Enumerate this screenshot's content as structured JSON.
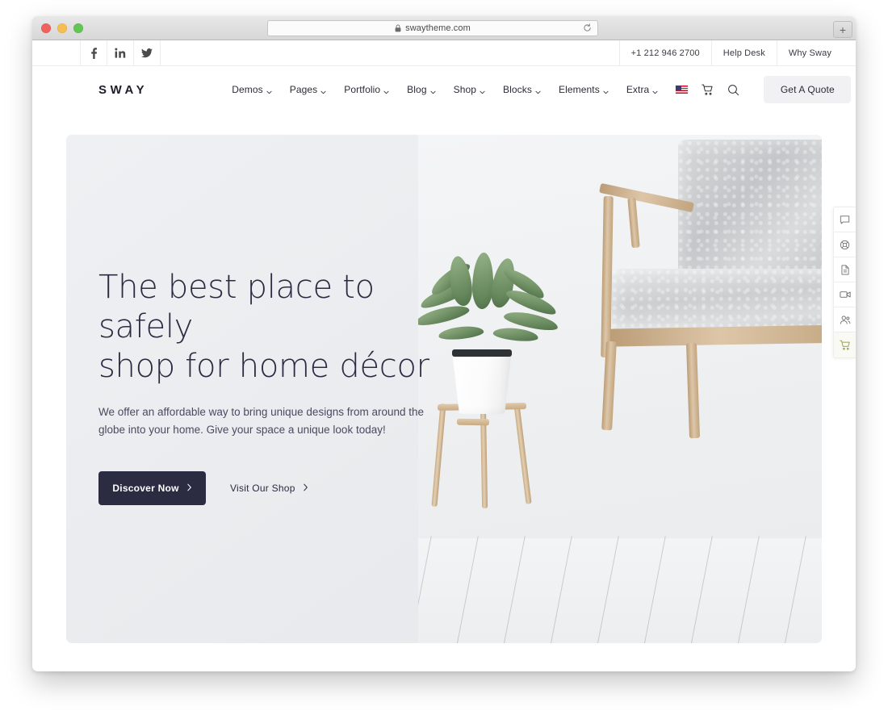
{
  "browser": {
    "url": "swaytheme.com",
    "lock_icon": "lock-icon",
    "reload_icon": "reload-icon",
    "new_tab_label": "+",
    "traffic_lights": [
      "close-button",
      "minimize-button",
      "maximize-button"
    ]
  },
  "topbar": {
    "social": [
      {
        "name": "facebook-icon",
        "label": "f"
      },
      {
        "name": "linkedin-icon",
        "label": "in"
      },
      {
        "name": "twitter-icon",
        "label": "twitter"
      }
    ],
    "links": [
      {
        "label": "+1 212 946 2700"
      },
      {
        "label": "Help Desk"
      },
      {
        "label": "Why Sway"
      }
    ]
  },
  "nav": {
    "logo": "SWAY",
    "menu": [
      {
        "label": "Demos",
        "has_dropdown": true
      },
      {
        "label": "Pages",
        "has_dropdown": true
      },
      {
        "label": "Portfolio",
        "has_dropdown": true
      },
      {
        "label": "Blog",
        "has_dropdown": true
      },
      {
        "label": "Shop",
        "has_dropdown": true
      },
      {
        "label": "Blocks",
        "has_dropdown": true
      },
      {
        "label": "Elements",
        "has_dropdown": true
      },
      {
        "label": "Extra",
        "has_dropdown": true
      }
    ],
    "icons": [
      {
        "name": "us-flag-icon"
      },
      {
        "name": "cart-icon"
      },
      {
        "name": "search-icon"
      }
    ],
    "quote_button": "Get A Quote"
  },
  "hero": {
    "title": "The best place to safely\nshop for home décor",
    "subtitle": "We offer an affordable way to bring unique designs from around the\nglobe into your home. Give your space a unique look today!",
    "primary_cta": "Discover Now",
    "secondary_cta": "Visit Our Shop",
    "arrow": "›",
    "background_color": "#eef0f3",
    "title_color": "#2b2b42",
    "primary_button_color": "#2b2b42"
  },
  "side_rail": {
    "items": [
      {
        "name": "chat-icon",
        "active": false
      },
      {
        "name": "support-circle-icon",
        "active": false
      },
      {
        "name": "document-icon",
        "active": false
      },
      {
        "name": "video-camera-icon",
        "active": false
      },
      {
        "name": "users-icon",
        "active": false
      },
      {
        "name": "cart-icon",
        "active": true
      }
    ],
    "active_color": "#9a9f4e",
    "active_background": "#fafaf4"
  }
}
